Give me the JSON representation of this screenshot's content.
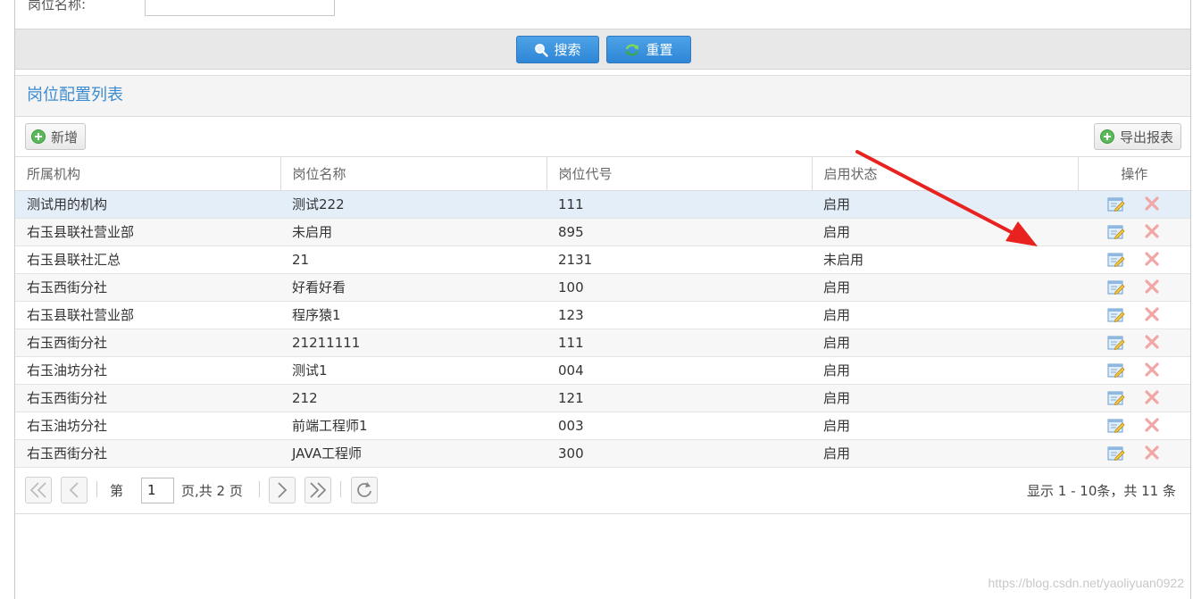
{
  "search": {
    "field_label": "岗位名称:",
    "field_value": "",
    "search_label": "搜索",
    "reset_label": "重置"
  },
  "panel": {
    "title": "岗位配置列表",
    "add_label": "新增",
    "export_label": "导出报表"
  },
  "table": {
    "columns": [
      "所属机构",
      "岗位名称",
      "岗位代号",
      "启用状态",
      "操作"
    ],
    "rows": [
      {
        "org": "测试用的机构",
        "name": "测试222",
        "code": "111",
        "status": "启用"
      },
      {
        "org": "右玉县联社营业部",
        "name": "未启用",
        "code": "895",
        "status": "启用"
      },
      {
        "org": "右玉县联社汇总",
        "name": "21",
        "code": "2131",
        "status": "未启用"
      },
      {
        "org": "右玉西街分社",
        "name": "好看好看",
        "code": "100",
        "status": "启用"
      },
      {
        "org": "右玉县联社营业部",
        "name": "程序猿1",
        "code": "123",
        "status": "启用"
      },
      {
        "org": "右玉西街分社",
        "name": "21211111",
        "code": "111",
        "status": "启用"
      },
      {
        "org": "右玉油坊分社",
        "name": "测试1",
        "code": "004",
        "status": "启用"
      },
      {
        "org": "右玉西街分社",
        "name": "212",
        "code": "121",
        "status": "启用"
      },
      {
        "org": "右玉油坊分社",
        "name": "前端工程师1",
        "code": "003",
        "status": "启用"
      },
      {
        "org": "右玉西街分社",
        "name": "JAVA工程师",
        "code": "300",
        "status": "启用"
      }
    ]
  },
  "pager": {
    "page_prefix": "第",
    "current_page": "1",
    "page_suffix": "页,共 2 页",
    "info": "显示 1 - 10条，共 11 条"
  },
  "watermark": "https://blog.csdn.net/yaoliyuan0922",
  "colors": {
    "accent": "#3b8bd0",
    "button_blue": "#2d86d6",
    "annotation_red": "#e8231f"
  },
  "icons": {
    "search": "search-icon",
    "reset": "refresh-icon",
    "add": "plus-circle-icon",
    "edit": "edit-icon",
    "delete": "delete-icon"
  }
}
